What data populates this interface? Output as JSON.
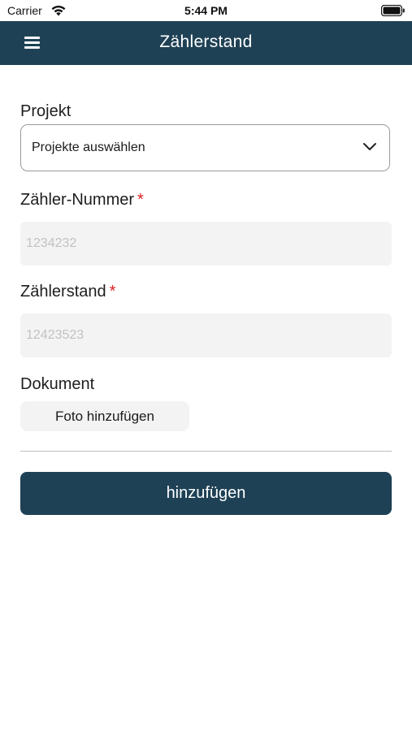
{
  "status_bar": {
    "carrier": "Carrier",
    "time": "5:44 PM",
    "icons": [
      "wifi-icon",
      "battery-icon"
    ]
  },
  "header": {
    "title": "Zählerstand",
    "menu_icon": "hamburger-menu-icon",
    "background_color": "#1f4155"
  },
  "form": {
    "project": {
      "label": "Projekt",
      "selected": "Projekte auswählen",
      "icon": "chevron-down-icon"
    },
    "meter_number": {
      "label": "Zähler-Nummer",
      "required_mark": "*",
      "placeholder": "1234232",
      "value": ""
    },
    "meter_reading": {
      "label": "Zählerstand",
      "required_mark": "*",
      "placeholder": "12423523",
      "value": ""
    },
    "document": {
      "label": "Dokument",
      "add_photo_label": "Foto hinzufügen"
    },
    "submit_label": "hinzufügen"
  },
  "colors": {
    "primary": "#1f4155",
    "required": "#e02020",
    "input_bg": "#f3f3f3"
  }
}
